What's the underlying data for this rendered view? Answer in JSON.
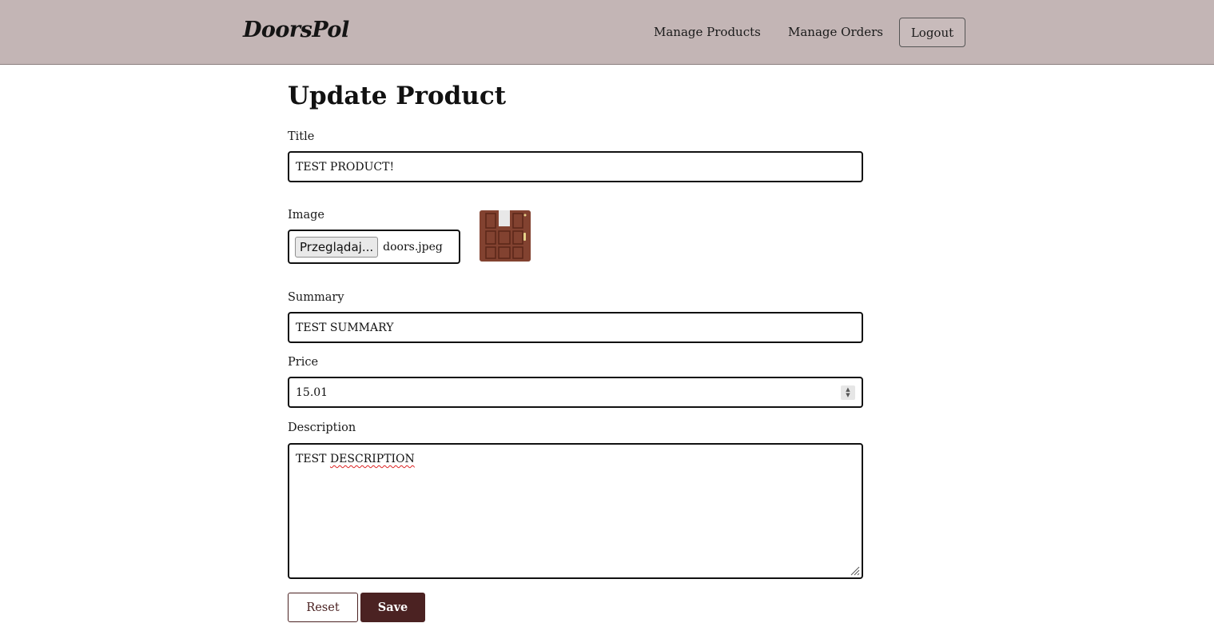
{
  "header": {
    "logo": "DoorsPol",
    "nav": {
      "manage_products": "Manage Products",
      "manage_orders": "Manage Orders",
      "logout": "Logout"
    },
    "background_color": "#c3b5b5"
  },
  "page": {
    "title": "Update Product"
  },
  "form": {
    "title": {
      "label": "Title",
      "value": "TEST PRODUCT!"
    },
    "image": {
      "label": "Image",
      "browse_label": "Przeglądaj...",
      "file_name": "doors.jpeg",
      "preview_icon": "door-image"
    },
    "summary": {
      "label": "Summary",
      "value": "TEST SUMMARY"
    },
    "price": {
      "label": "Price",
      "value": "15.01"
    },
    "description": {
      "label": "Description",
      "value_word1": "TEST",
      "value_word2": "DESCRIPTION"
    },
    "buttons": {
      "reset": "Reset",
      "save": "Save"
    },
    "accent_color": "#4b2222"
  }
}
